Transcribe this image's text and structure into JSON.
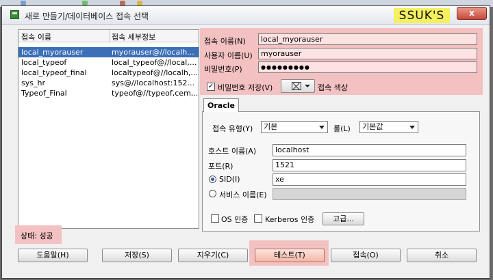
{
  "window": {
    "title": "새로 만들기/데이터베이스 접속 선택",
    "brand_label": "SSUK'S",
    "close_label": "x"
  },
  "connection_list": {
    "columns": [
      "접속 이름",
      "접속 세부정보"
    ],
    "rows": [
      {
        "name": "local_myorauser",
        "details": "myorauser@//localh...",
        "selected": true
      },
      {
        "name": "local_typeof",
        "details": "local_typeof@//local,..."
      },
      {
        "name": "local_typeof_final",
        "details": "localtypeof@//localh,..."
      },
      {
        "name": "sys_hr",
        "details": "sys@//localhost:152..."
      },
      {
        "name": "Typeof_Final",
        "details": "typeof@//typeof,cem,..."
      }
    ]
  },
  "form": {
    "conn_name_label": "접속 이름(N)",
    "conn_name_value": "local_myorauser",
    "username_label": "사용자 이름(U)",
    "username_value": "myorauser",
    "password_label": "비밀번호(P)",
    "password_value": "●●●●●●●●●",
    "save_password_label": "비밀번호 저장(V)",
    "save_password_checked": true,
    "conn_color_label": "접속 색상"
  },
  "oracle_tab": {
    "tab_label": "Oracle",
    "conn_type_label": "접속 유형(Y)",
    "conn_type_value": "기본",
    "role_label": "롤(L)",
    "role_value": "기본값",
    "host_label": "호스트 이름(A)",
    "host_value": "localhost",
    "port_label": "포트(R)",
    "port_value": "1521",
    "sid_label": "SID(I)",
    "sid_value": "xe",
    "service_label": "서비스 이름(E)",
    "service_value": "",
    "os_auth_label": "OS 인증",
    "kerberos_label": "Kerberos 인증",
    "advanced_label": "고급..."
  },
  "status": {
    "text": "상태: 성공"
  },
  "buttons": {
    "help": "도움말(H)",
    "save": "저장(S)",
    "clear": "지우기(C)",
    "test": "테스트(T)",
    "connect": "접속(O)",
    "cancel": "취소"
  },
  "colors": {
    "highlight": "#f3c1c2",
    "selection": "#3b6fb6",
    "brand_bg": "#f4f060"
  }
}
